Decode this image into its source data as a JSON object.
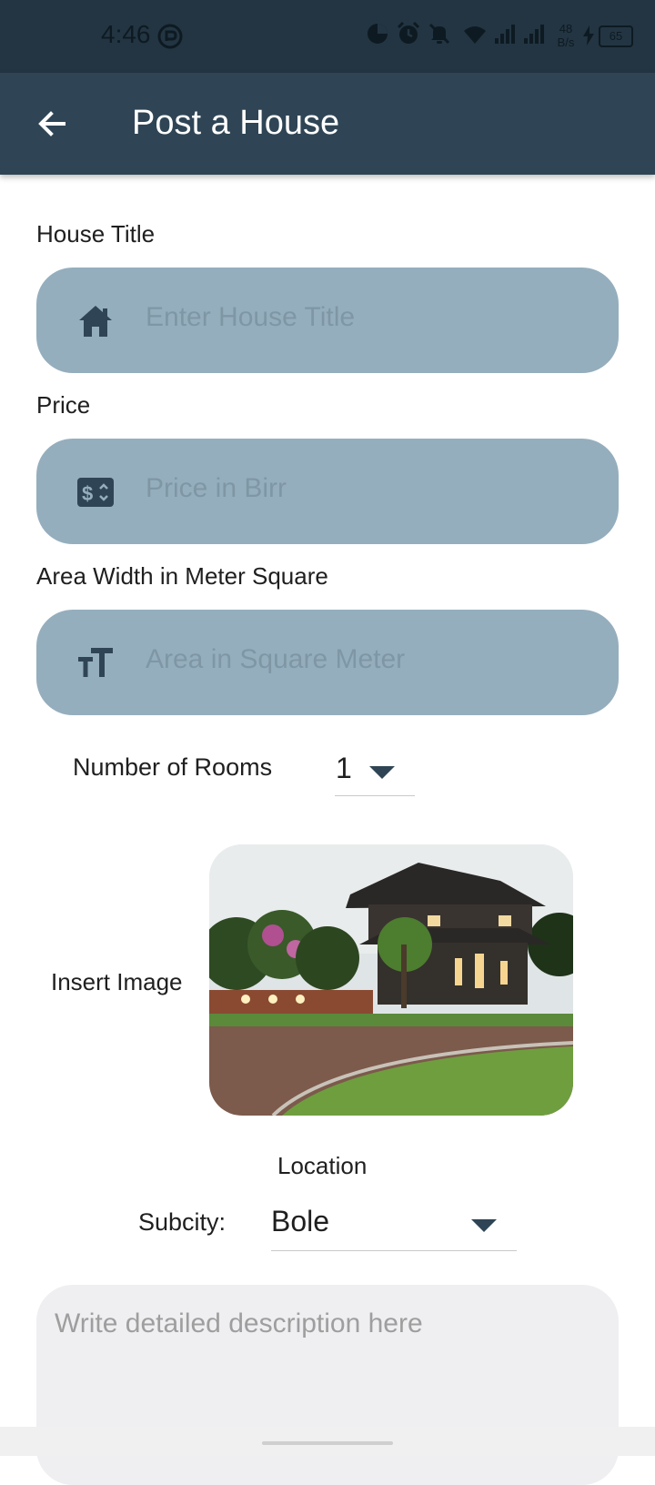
{
  "status_bar": {
    "time": "4:46",
    "net_speed_value": "48",
    "net_speed_unit": "B/s",
    "battery": "65"
  },
  "app_bar": {
    "title": "Post a House",
    "back_icon": "arrow-left-icon"
  },
  "form": {
    "house_title": {
      "label": "House Title",
      "placeholder": "Enter House Title",
      "value": "",
      "icon": "house-icon"
    },
    "price": {
      "label": "Price",
      "placeholder": "Price in Birr",
      "value": "",
      "icon": "price-tag-icon"
    },
    "area": {
      "label": "Area Width in Meter Square",
      "placeholder": "Area in Square Meter",
      "value": "",
      "icon": "text-size-icon"
    },
    "rooms": {
      "label": "Number of Rooms",
      "value": "1"
    },
    "image": {
      "label": "Insert Image"
    },
    "location": {
      "label": "Location",
      "subcity_label": "Subcity:",
      "subcity_value": "Bole"
    },
    "description": {
      "placeholder": "Write detailed description here",
      "value": ""
    }
  },
  "colors": {
    "status_bar": "#233542",
    "app_bar": "#2f4555",
    "field_bg": "#95aebd",
    "description_bg": "#efeff2"
  }
}
